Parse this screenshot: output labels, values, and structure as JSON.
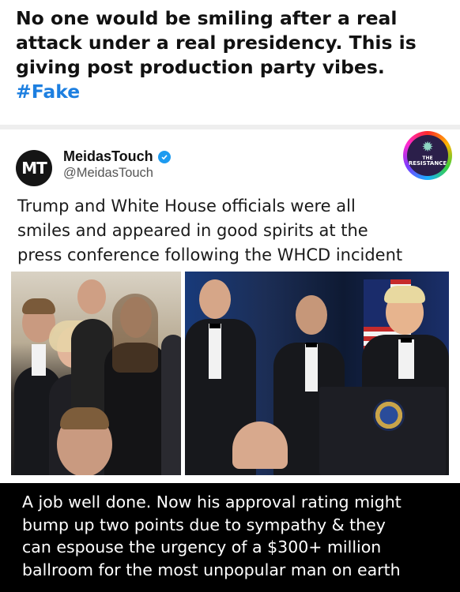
{
  "caption": {
    "line1": "No one would be smiling after a real",
    "line2": "attack under a real presidency. This is",
    "line3": "giving post production party vibes.",
    "hashtag": "#Fake"
  },
  "tweet": {
    "avatar_text": "MT",
    "author": "MeidasTouch",
    "handle": "@MeidasTouch",
    "badge": "THE RESISTANCE",
    "badge_line1": "THE",
    "badge_line2": "RESISTANCE",
    "text_line1": "Trump and White House officials were all",
    "text_line2": "smiles and appeared in good spirits at the",
    "text_line3": "press conference following the WHCD incident",
    "verified_color": "#1d9bf0"
  },
  "photos": [
    {
      "name": "group-photo-left"
    },
    {
      "name": "podium-photo-right"
    }
  ],
  "bottom_caption": {
    "line1": "A job well done. Now his approval rating might",
    "line2": "bump up two points due to sympathy & they",
    "line3": "can espouse the urgency of a $300+ million",
    "line4": "ballroom for the most unpopular man on earth"
  },
  "colors": {
    "hashtag": "#1d7fe0",
    "bottom_background": "#000000"
  }
}
